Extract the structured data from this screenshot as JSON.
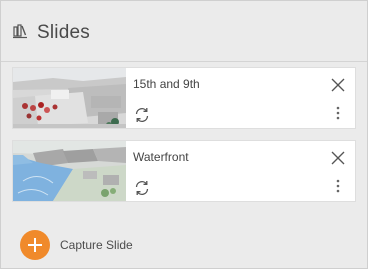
{
  "header": {
    "title": "Slides",
    "icon": "slides-icon"
  },
  "slides": [
    {
      "title": "15th and 9th",
      "thumbnail": "city-aerial-thumbnail"
    },
    {
      "title": "Waterfront",
      "thumbnail": "waterfront-aerial-thumbnail"
    }
  ],
  "capture": {
    "label": "Capture Slide",
    "color": "#f08a2b"
  }
}
